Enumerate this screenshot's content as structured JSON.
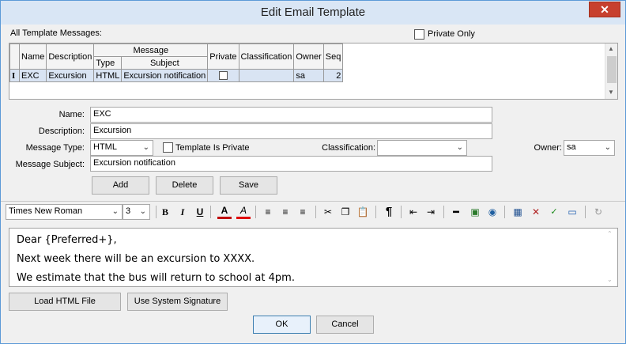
{
  "window": {
    "title": "Edit Email Template",
    "close_glyph": "✕"
  },
  "templates": {
    "label": "All Template Messages:",
    "private_only_label": "Private Only",
    "group_header": "Message",
    "columns": {
      "name": "Name",
      "description": "Description",
      "type": "Type",
      "subject": "Subject",
      "private": "Private",
      "classification": "Classification",
      "owner": "Owner",
      "seq": "Seq"
    },
    "rows": [
      {
        "marker": "I",
        "name": "EXC",
        "description": "Excursion",
        "type": "HTML",
        "subject": "Excursion notification",
        "private": false,
        "classification": "",
        "owner": "sa",
        "seq": "2"
      }
    ]
  },
  "form": {
    "name_label": "Name:",
    "name_value": "EXC",
    "description_label": "Description:",
    "description_value": "Excursion",
    "message_type_label": "Message Type:",
    "message_type_value": "HTML",
    "template_private_label": "Template Is Private",
    "classification_label": "Classification:",
    "classification_value": "",
    "owner_label": "Owner:",
    "owner_value": "sa",
    "subject_label": "Message Subject:",
    "subject_value": "Excursion notification"
  },
  "actions": {
    "add": "Add",
    "delete": "Delete",
    "save": "Save"
  },
  "toolbar": {
    "font_value": "Times New Roman",
    "size_value": "3",
    "bold": "B",
    "italic": "I",
    "underline": "U",
    "text_color_glyph": "A",
    "highlight_glyph": "A",
    "paragraph_glyph": "¶"
  },
  "editor": {
    "lines": [
      "Dear {Preferred+},",
      "Next week there will be an excursion to XXXX.",
      "We estimate that the bus will return to school at 4pm."
    ]
  },
  "bottom": {
    "load_html": "Load HTML File",
    "use_signature": "Use System Signature",
    "ok": "OK",
    "cancel": "Cancel"
  },
  "colors": {
    "text_color": "#c00000",
    "highlight_color": "#e00000",
    "accent": "#3c7fb1"
  }
}
